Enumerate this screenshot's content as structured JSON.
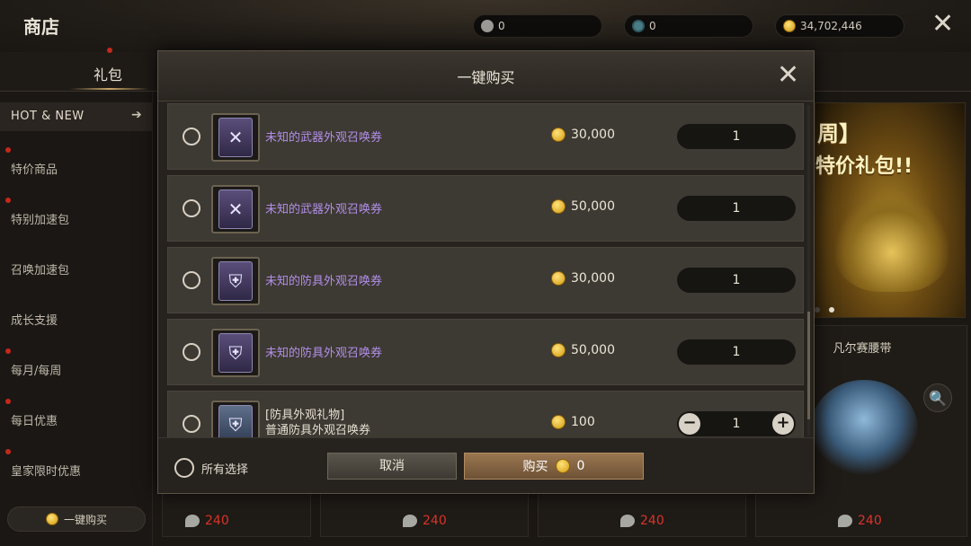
{
  "header": {
    "title": "商店",
    "currencies": [
      {
        "icon": "feather-icon",
        "value": "0"
      },
      {
        "icon": "gem-icon",
        "value": "0"
      },
      {
        "icon": "gold-coin-icon",
        "value": "34,702,446"
      }
    ],
    "close_glyph": "✕"
  },
  "tabs": {
    "active": "礼包"
  },
  "sidebar": {
    "hot_label": "HOT & NEW",
    "hot_arrow": "➔",
    "items": [
      "特价商品",
      "特别加速包",
      "召唤加速包",
      "成长支援",
      "每月/每周",
      "每日优惠",
      "皇家限时优惠"
    ],
    "one_click_label": "一键购买"
  },
  "banner": {
    "line1": "周】",
    "line2": "特价礼包!!"
  },
  "right_card": {
    "title": "凡尔赛腰带",
    "zoom_glyph": "🔍"
  },
  "bottom_prices": [
    "240",
    "240",
    "240",
    "240"
  ],
  "modal": {
    "title": "一键购买",
    "close_glyph": "✕",
    "items": [
      {
        "name": "未知的武器外观召唤券",
        "price": "30,000",
        "qty": "1",
        "icon": "weapon-ticket-icon",
        "glyph": "✕"
      },
      {
        "name": "未知的武器外观召唤券",
        "price": "50,000",
        "qty": "1",
        "icon": "weapon-ticket-icon",
        "glyph": "✕"
      },
      {
        "name": "未知的防具外观召唤券",
        "price": "30,000",
        "qty": "1",
        "icon": "armor-ticket-icon",
        "glyph": "⛨"
      },
      {
        "name": "未知的防具外观召唤券",
        "price": "50,000",
        "qty": "1",
        "icon": "armor-ticket-icon",
        "glyph": "⛨"
      },
      {
        "name_line1": "[防具外观礼物]",
        "name_line2": "普通防具外观召唤券",
        "price": "100",
        "qty": "1",
        "icon": "armor-ticket-icon",
        "glyph": "⛨",
        "minus": "−",
        "plus": "+"
      }
    ],
    "select_all_label": "所有选择",
    "cancel_label": "取消",
    "buy_label": "购买",
    "buy_total": "0"
  },
  "colors": {
    "accent_gold": "#d29a10",
    "purple_item": "#b28fe8",
    "price_red": "#d8352a"
  }
}
